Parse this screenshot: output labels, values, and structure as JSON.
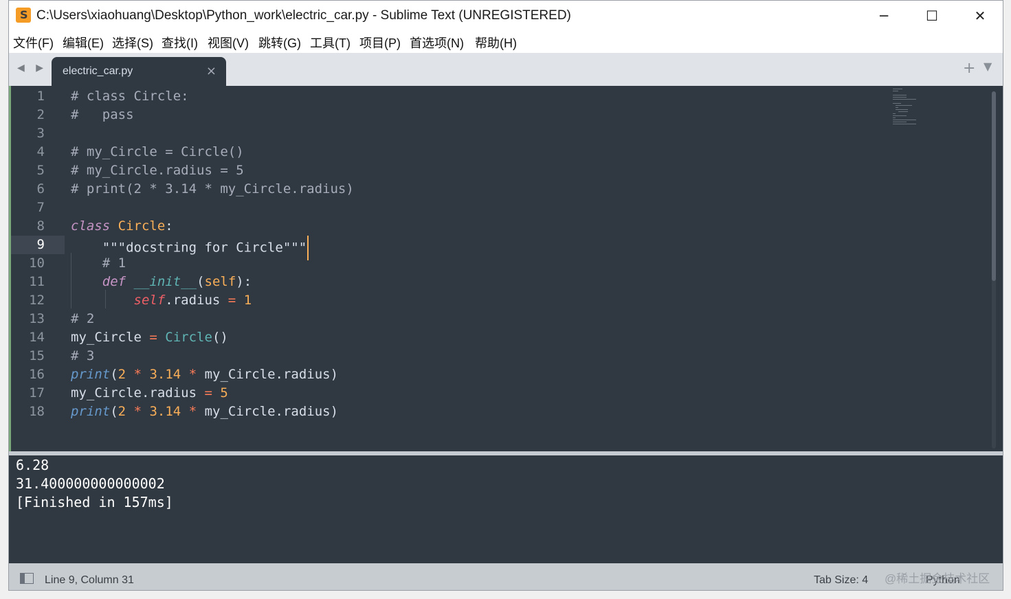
{
  "window": {
    "title": "C:\\Users\\xiaohuang\\Desktop\\Python_work\\electric_car.py - Sublime Text (UNREGISTERED)",
    "controls": {
      "minimize": "─",
      "maximize": "☐",
      "close": "✕"
    }
  },
  "menu": [
    "文件(F)",
    "编辑(E)",
    "选择(S)",
    "查找(I)",
    "视图(V)",
    "跳转(G)",
    "工具(T)",
    "项目(P)",
    "首选项(N)",
    "帮助(H)"
  ],
  "tabs": {
    "nav_arrows": "◀ ▶",
    "active_tab": "electric_car.py",
    "close_glyph": "×",
    "new_tab_glyph": "+",
    "menu_glyph": "▼"
  },
  "editor": {
    "active_line": 9,
    "line_numbers": [
      "1",
      "2",
      "3",
      "4",
      "5",
      "6",
      "7",
      "8",
      "9",
      "10",
      "11",
      "12",
      "13",
      "14",
      "15",
      "16",
      "17",
      "18"
    ],
    "lines": [
      "# class Circle:",
      "#   pass",
      "",
      "# my_Circle = Circle()",
      "# my_Circle.radius = 5",
      "# print(2 * 3.14 * my_Circle.radius)",
      "",
      "class Circle:",
      "    \"\"\"docstring for Circle\"\"\"",
      "    # 1",
      "    def __init__(self):",
      "        self.radius = 1",
      "# 2",
      "my_Circle = Circle()",
      "# 3",
      "print(2 * 3.14 * my_Circle.radius)",
      "my_Circle.radius = 5",
      "print(2 * 3.14 * my_Circle.radius)"
    ]
  },
  "output": {
    "lines": [
      "6.28",
      "31.400000000000002",
      "[Finished in 157ms]"
    ]
  },
  "status": {
    "position": "Line 9, Column 31",
    "tab_size": "Tab Size: 4",
    "syntax": "Python",
    "watermark": "@稀土掘金技术社区"
  },
  "colors": {
    "editor_bg": "#303841",
    "comment": "#a7adba",
    "keyword": "#c594c5",
    "class_name": "#f9ae58",
    "self": "#ec5f66",
    "function": "#5fb4b4",
    "builtin": "#6699cc"
  }
}
